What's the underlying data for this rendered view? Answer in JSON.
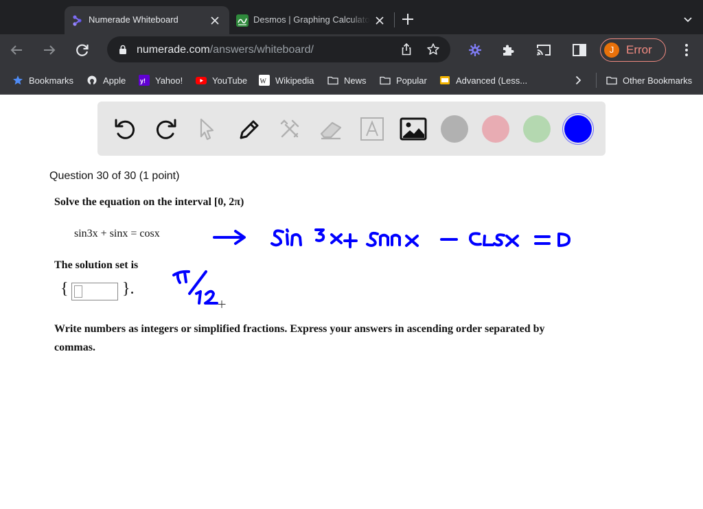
{
  "browser": {
    "tabs": [
      {
        "title": "Numerade Whiteboard",
        "active": true,
        "favicon": "numerade-logo-icon"
      },
      {
        "title": "Desmos | Graphing Calculator",
        "active": false,
        "favicon": "desmos-logo-icon"
      }
    ],
    "url_domain": "numerade.com",
    "url_path": "/answers/whiteboard/",
    "profile": {
      "initial": "J",
      "status": "Error"
    },
    "bookmarks": [
      {
        "label": "Bookmarks",
        "icon": "star-icon"
      },
      {
        "label": "Apple",
        "icon": "apple-icon"
      },
      {
        "label": "Yahoo!",
        "icon": "yahoo-icon"
      },
      {
        "label": "YouTube",
        "icon": "youtube-icon"
      },
      {
        "label": "Wikipedia",
        "icon": "wikipedia-icon"
      },
      {
        "label": "News",
        "icon": "folder-icon"
      },
      {
        "label": "Popular",
        "icon": "folder-icon"
      },
      {
        "label": "Advanced (Less...",
        "icon": "page-icon"
      }
    ],
    "other_bookmarks": "Other Bookmarks"
  },
  "whiteboard": {
    "tools": [
      "undo-icon",
      "redo-icon",
      "pointer-icon",
      "pen-icon",
      "tools-icon",
      "eraser-icon",
      "text-icon",
      "image-icon"
    ],
    "colors": [
      "#b1b1b1",
      "#e8acb3",
      "#b4d8b0",
      "#0000ff"
    ],
    "selected_color": "#0000ff",
    "ink_color": "#0000ff"
  },
  "question": {
    "header": "Question 30 of 30 (1 point)",
    "prompt": "Solve the equation on the interval [0, 2π)",
    "equation": "sin3x + sinx = cosx",
    "solution_label": "The solution set is",
    "brace_open": "{",
    "brace_close": "}.",
    "answer_value": "",
    "instructions": "Write numbers as integers or simplified fractions. Express your answers in ascending order separated by commas."
  }
}
